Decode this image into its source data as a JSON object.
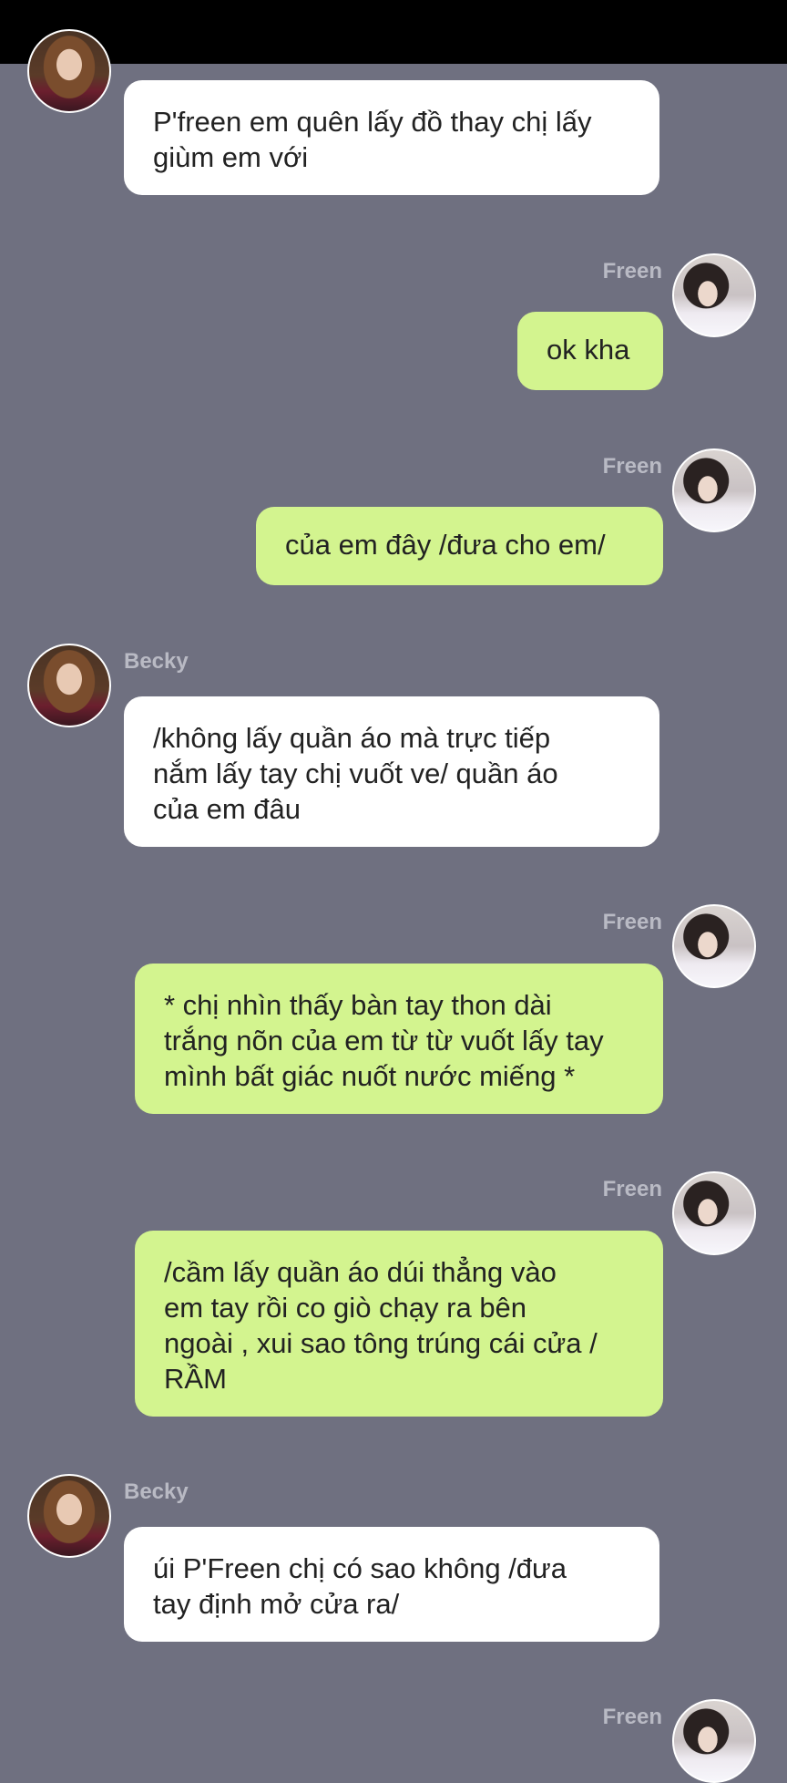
{
  "messages": [
    {
      "sender": "Becky",
      "side": "left",
      "show_name": false,
      "lines": [
        "P'freen em quên lấy đồ thay chị lấy",
        "giùm em với"
      ]
    },
    {
      "sender": "Freen",
      "side": "right",
      "show_name": true,
      "lines": [
        "ok kha"
      ]
    },
    {
      "sender": "Freen",
      "side": "right",
      "show_name": true,
      "lines": [
        "của em đây /đưa cho em/"
      ]
    },
    {
      "sender": "Becky",
      "side": "left",
      "show_name": true,
      "lines": [
        "/không lấy quần áo mà trực tiếp",
        "nắm lấy tay chị vuốt ve/ quần áo",
        "của em đâu"
      ]
    },
    {
      "sender": "Freen",
      "side": "right",
      "show_name": true,
      "lines": [
        "* chị nhìn thấy bàn tay thon dài",
        "trắng nõn của em từ từ vuốt lấy tay",
        "mình bất giác nuốt nước miếng *"
      ]
    },
    {
      "sender": "Freen",
      "side": "right",
      "show_name": true,
      "lines": [
        "/cầm lấy quần áo dúi thẳng vào",
        "em tay rồi co giò chạy ra bên",
        "ngoài , xui sao tông trúng cái cửa /",
        "RẦM"
      ]
    },
    {
      "sender": "Becky",
      "side": "left",
      "show_name": true,
      "lines": [
        "úi P'Freen chị có sao không /đưa",
        "tay định mở cửa ra/"
      ]
    },
    {
      "sender": "Freen",
      "side": "right",
      "show_name": true,
      "lines": []
    }
  ],
  "colors": {
    "background": "#6f7080",
    "left_bubble": "#ffffff",
    "right_bubble": "#d3f48f",
    "name": "#b9bac4"
  }
}
